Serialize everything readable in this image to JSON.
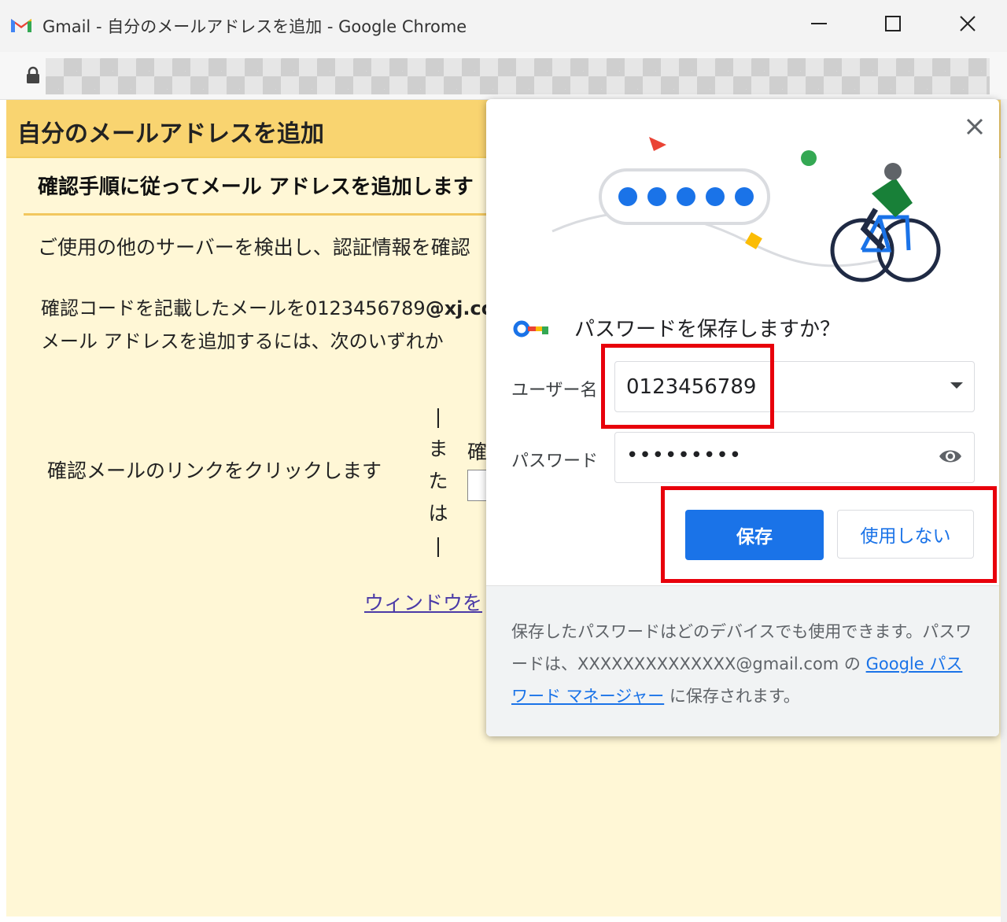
{
  "window": {
    "title": "Gmail - 自分のメールアドレスを追加 - Google Chrome"
  },
  "page": {
    "title": "自分のメールアドレスを追加",
    "subtitle": "確認手順に従ってメール アドレスを追加します",
    "description": "ご使用の他のサーバーを検出し、認証情報を確認",
    "code_line_prefix": "確認コードを記載したメールを0123456789",
    "code_line_bold": "@xj.co",
    "code_line2": "メール アドレスを追加するには、次のいずれか",
    "click_link_text": "確認メールのリンクをクリックします",
    "or_separator": [
      "|",
      "ま",
      "た",
      "は",
      "|"
    ],
    "confirm_fragment": "確",
    "window_link": "ウィンドウを"
  },
  "dialog": {
    "title": "パスワードを保存しますか？",
    "username_label": "ユーザー名",
    "username_value": "0123456789",
    "password_label": "パスワード",
    "password_value": "•••••••••",
    "save_button": "保存",
    "never_button": "使用しない",
    "footer_prefix": "保存したパスワードはどのデバイスでも使用できます。パスワードは、XXXXXXXXXXXXXX@gmail.com の ",
    "footer_link": "Google パスワード マネージャー",
    "footer_suffix": " に保存されます。"
  },
  "colors": {
    "accent_blue": "#1a73e8",
    "header_yellow": "#f9d470",
    "page_bg": "#fff7d6",
    "highlight_red": "#e8000b"
  },
  "icons": {
    "gmail": "gmail-logo-icon",
    "lock": "lock-icon",
    "key": "key-icon",
    "eye": "eye-icon",
    "close": "close-icon",
    "dropdown": "chevron-down-icon"
  }
}
